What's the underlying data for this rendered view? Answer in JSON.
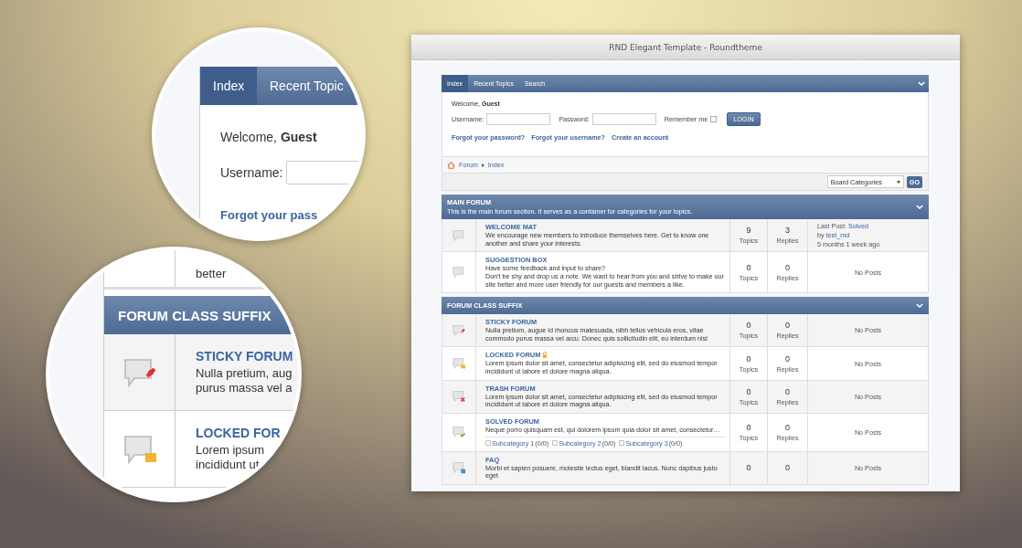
{
  "window": {
    "title": "RND Elegant Template - Roundtheme"
  },
  "nav": {
    "tabs": [
      {
        "label": "Index",
        "selected": true
      },
      {
        "label": "Recent Topics",
        "selected": false
      },
      {
        "label": "Search",
        "selected": false
      }
    ]
  },
  "login": {
    "greeting": "Welcome,",
    "user": "Guest",
    "fields": [
      {
        "label": "Username:"
      },
      {
        "label": "Password:"
      }
    ],
    "remember": {
      "label": "Remember me",
      "checked": false
    },
    "button": "LOGIN",
    "links": [
      "Forgot your password?",
      "Forgot your username?",
      "Create an account"
    ]
  },
  "breadcrumb": [
    "Forum",
    "Index"
  ],
  "jump": {
    "select": "Board Categories",
    "button": "GO"
  },
  "sections": [
    {
      "title": "MAIN FORUM",
      "description": "This is the main forum section. It serves as a container for categories for your topics.",
      "forums": [
        {
          "kind": "plain",
          "name": "WELCOME MAT",
          "locked": false,
          "description": "We encourage new members to introduce themselves here. Get to know one another and share your interests.",
          "topics": "9",
          "topics_label": "Topics",
          "replies": "3",
          "replies_label": "Replies",
          "last": {
            "kind": "post",
            "label": "Last Post:",
            "topic": "Solved",
            "by": "by",
            "user": "test_md",
            "time": "5 months 1 week ago"
          }
        },
        {
          "kind": "plain",
          "name": "SUGGESTION BOX",
          "locked": false,
          "description": "Have some feedback and input to share?\nDon't be shy and drop us a note. We want to hear from you and strive to make our site better and more user friendly for our guests and members a like.",
          "topics": "0",
          "topics_label": "Topics",
          "replies": "0",
          "replies_label": "Replies",
          "last": {
            "kind": "none",
            "text": "No Posts"
          }
        }
      ]
    },
    {
      "title": "FORUM CLASS SUFFIX",
      "forums": [
        {
          "kind": "sticky",
          "name": "STICKY FORUM",
          "locked": false,
          "description": "Nulla pretium, augue id rhoncus malesuada, nibh tellus vehicula eros, vitae commodo purus massa vel arcu. Donec quis sollicitudin elit, eu interdum nisl",
          "topics": "0",
          "topics_label": "Topics",
          "replies": "0",
          "replies_label": "Replies",
          "last": {
            "kind": "none",
            "text": "No Posts"
          }
        },
        {
          "kind": "locked",
          "name": "LOCKED FORUM",
          "locked": true,
          "description": "Lorem ipsum dolor sit amet, consectetur adipisicing elit, sed do eiusmod tempor incididunt ut labore et dolore magna aliqua.",
          "topics": "0",
          "topics_label": "Topics",
          "replies": "0",
          "replies_label": "Replies",
          "last": {
            "kind": "none",
            "text": "No Posts"
          }
        },
        {
          "kind": "trash",
          "name": "TRASH FORUM",
          "locked": false,
          "description": "Lorem ipsum dolor sit amet, consectetur adipisicing elit, sed do eiusmod tempor incididunt ut labore et dolore magna aliqua.",
          "topics": "0",
          "topics_label": "Topics",
          "replies": "0",
          "replies_label": "Replies",
          "last": {
            "kind": "none",
            "text": "No Posts"
          }
        },
        {
          "kind": "solved",
          "name": "SOLVED FORUM",
          "locked": false,
          "description": "Neque porro quisquam est, qui dolorem ipsum quia dolor sit amet, consectetur…",
          "subcategories": [
            {
              "name": "Subcategory 1",
              "count": "(0/0)"
            },
            {
              "name": "Subcategory 2",
              "count": "(0/0)"
            },
            {
              "name": "Subcategory 3",
              "count": "(0/0)"
            }
          ],
          "topics": "0",
          "topics_label": "Topics",
          "replies": "0",
          "replies_label": "Replies",
          "last": {
            "kind": "none",
            "text": "No Posts"
          }
        },
        {
          "kind": "faq",
          "name": "FAQ",
          "locked": false,
          "description": "Morbi et sapien posuere, molestie lectus eget, blandit lacus. Nunc dapibus justo eget",
          "topics": "0",
          "replies": "0",
          "last": {
            "kind": "none",
            "text": "No Posts"
          }
        }
      ]
    }
  ],
  "magnifiers": [
    {
      "kind": "login",
      "tabs": [
        {
          "label": "Index",
          "selected": true
        },
        {
          "label": "Recent Topic",
          "selected": false
        }
      ],
      "greeting": "Welcome,",
      "user": "Guest",
      "field_label": "Username:",
      "link": "Forgot your pass"
    },
    {
      "kind": "forums",
      "above": "better",
      "header": "FORUM CLASS SUFFIX",
      "forums": [
        {
          "kind": "sticky",
          "name": "STICKY FORUM",
          "lines": [
            "Nulla pretium, aug",
            "purus massa vel a"
          ]
        },
        {
          "kind": "locked",
          "name": "LOCKED FOR",
          "lines": [
            "Lorem ipsum",
            "incididunt ut"
          ]
        }
      ]
    }
  ]
}
